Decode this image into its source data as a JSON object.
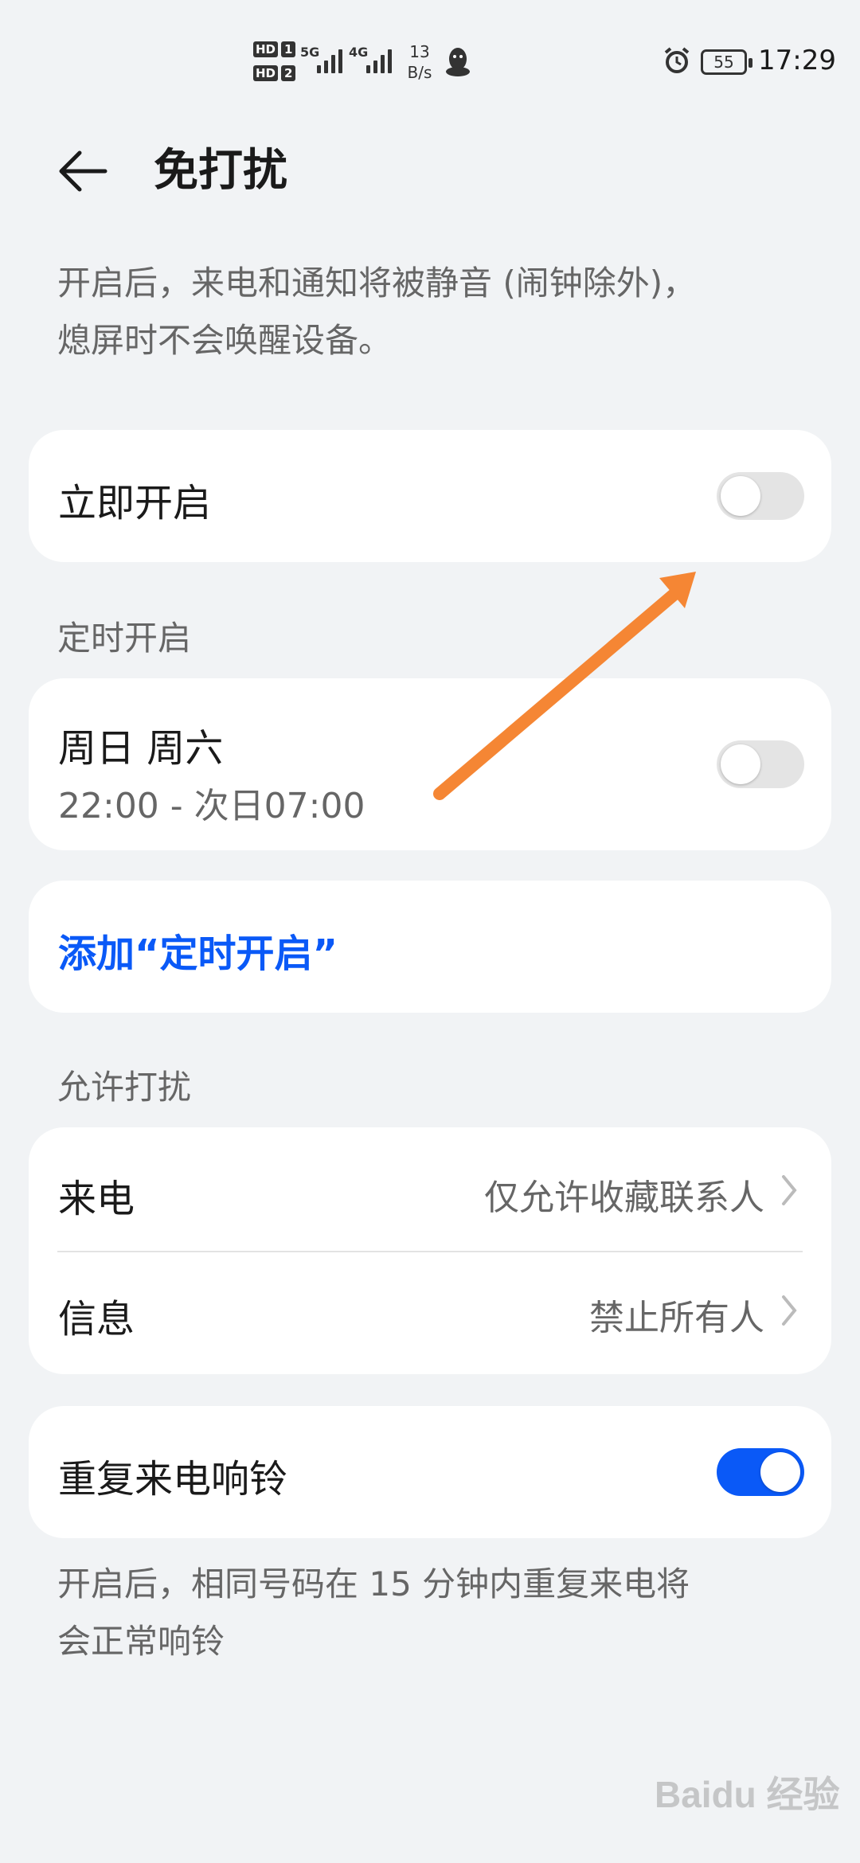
{
  "status_bar": {
    "sim1": {
      "tag": "HD",
      "num": "1"
    },
    "sim2": {
      "tag": "HD",
      "num": "2"
    },
    "net1": "5G",
    "net2": "4G",
    "speed_value": "13",
    "speed_unit": "B/s",
    "battery": "55",
    "time": "17:29",
    "icons": [
      "qq-icon",
      "alarm-icon"
    ]
  },
  "header": {
    "back_icon": "arrow-left-icon",
    "title": "免打扰"
  },
  "intro": {
    "line1": "开启后，来电和通知将被静音 (闹钟除外)，",
    "line2": "熄屏时不会唤醒设备。"
  },
  "immediate": {
    "label": "立即开启",
    "enabled": false
  },
  "schedule_section": {
    "label": "定时开启",
    "items": [
      {
        "days": "周日 周六",
        "time_range": "22:00 - 次日07:00",
        "enabled": false
      }
    ],
    "add_label": "添加“定时开启”"
  },
  "allow_section": {
    "label": "允许打扰",
    "items": [
      {
        "label": "来电",
        "value": "仅允许收藏联系人"
      },
      {
        "label": "信息",
        "value": "禁止所有人"
      }
    ]
  },
  "repeat_calls": {
    "label": "重复来电响铃",
    "enabled": true,
    "note_line1": "开启后，相同号码在 15 分钟内重复来电将",
    "note_line2": "会正常响铃"
  },
  "annotation": {
    "arrow_color": "#f58634"
  },
  "watermark": "Baidu 经验",
  "colors": {
    "accent": "#0a59f7",
    "background": "#f1f3f5",
    "card": "#ffffff",
    "secondary_text": "#666666"
  }
}
